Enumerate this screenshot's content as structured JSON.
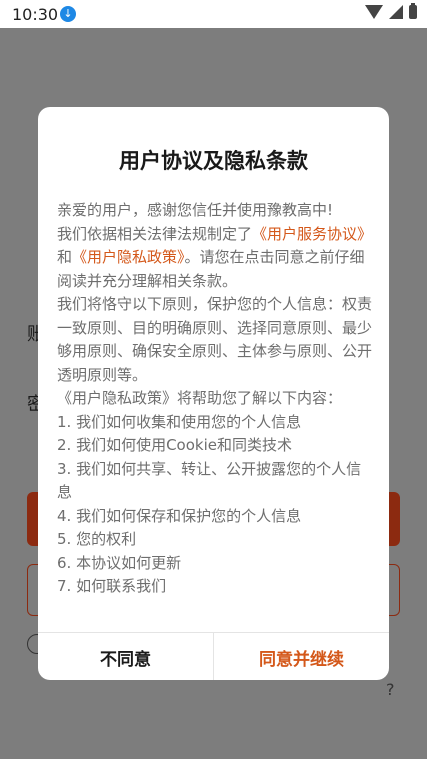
{
  "status_bar": {
    "time": "10:30"
  },
  "dialog": {
    "title": "用户协议及隐私条款",
    "intro": "亲爱的用户，感谢您信任并使用豫教高中!",
    "line2_pre": "我们依据相关法律法规制定了",
    "link_service": "《用户服务协议》",
    "line2_and": "和",
    "link_privacy": "《用户隐私政策》",
    "line2_post": "。请您在点击同意之前仔细阅读并充分理解相关条款。",
    "principles": "我们将恪守以下原则，保护您的个人信息：权责一致原则、目的明确原则、选择同意原则、最少够用原则、确保安全原则、主体参与原则、公开透明原则等。",
    "policy_intro": "《用户隐私政策》将帮助您了解以下内容：",
    "items": [
      "1. 我们如何收集和使用您的个人信息",
      "2. 我们如何使用Cookie和同类技术",
      "3. 我们如何共享、转让、公开披露您的个人信息",
      "4. 我们如何保存和保护您的个人信息",
      "5. 您的权利",
      "6. 本协议如何更新",
      "7. 如何联系我们"
    ],
    "disagree_label": "不同意",
    "agree_label": "同意并继续"
  },
  "background": {
    "label_account_partial": "账",
    "label_password_partial": "密",
    "help_partial": "?"
  }
}
